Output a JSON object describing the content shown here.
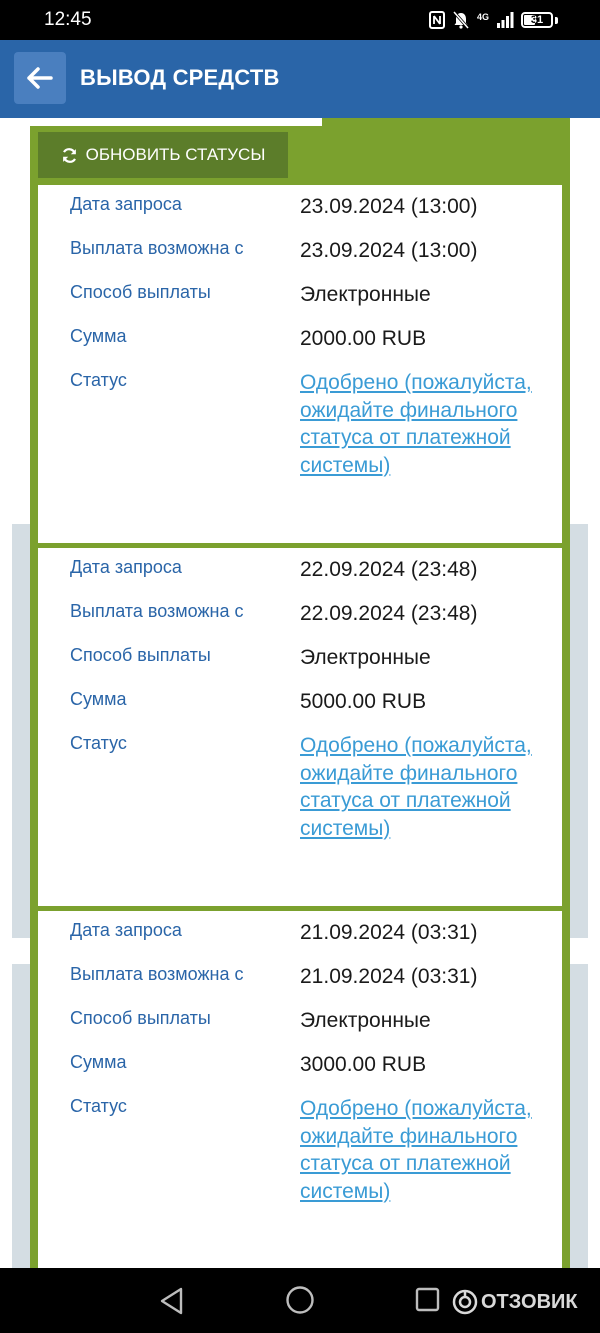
{
  "status_bar": {
    "time": "12:45",
    "network": "4G",
    "battery": "31",
    "icons": [
      "nfc-icon",
      "mute-icon",
      "signal-icon",
      "battery-icon"
    ]
  },
  "header": {
    "title": "ВЫВОД СРЕДСТВ",
    "back_icon": "arrow-left-icon",
    "color": "#2a65a8"
  },
  "toolbar": {
    "refresh_label": "ОБНОВИТЬ СТАТУСЫ",
    "refresh_icon": "refresh-icon"
  },
  "labels": {
    "request_date": "Дата запроса",
    "payout_from": "Выплата возможна с",
    "method": "Способ выплаты",
    "amount": "Сумма",
    "status": "Статус"
  },
  "requests": [
    {
      "request_date": "23.09.2024 (13:00)",
      "payout_from": "23.09.2024 (13:00)",
      "method": "Электронные",
      "amount": "2000.00 RUB",
      "status": "Одобрено (пожалуйста, ожидайте финального статуса от платежной системы)"
    },
    {
      "request_date": "22.09.2024 (23:48)",
      "payout_from": "22.09.2024 (23:48)",
      "method": "Электронные",
      "amount": "5000.00 RUB",
      "status": "Одобрено (пожалуйста, ожидайте финального статуса от платежной системы)"
    },
    {
      "request_date": "21.09.2024 (03:31)",
      "payout_from": "21.09.2024 (03:31)",
      "method": "Электронные",
      "amount": "3000.00 RUB",
      "status": "Одобрено (пожалуйста, ожидайте финального статуса от платежной системы)"
    }
  ],
  "colors": {
    "panel_green": "#7ba12e",
    "button_green": "#5c7d2a",
    "label_blue": "#2a65a8",
    "link_blue": "#3a9bd5"
  },
  "watermark": "ОТЗОВИК"
}
